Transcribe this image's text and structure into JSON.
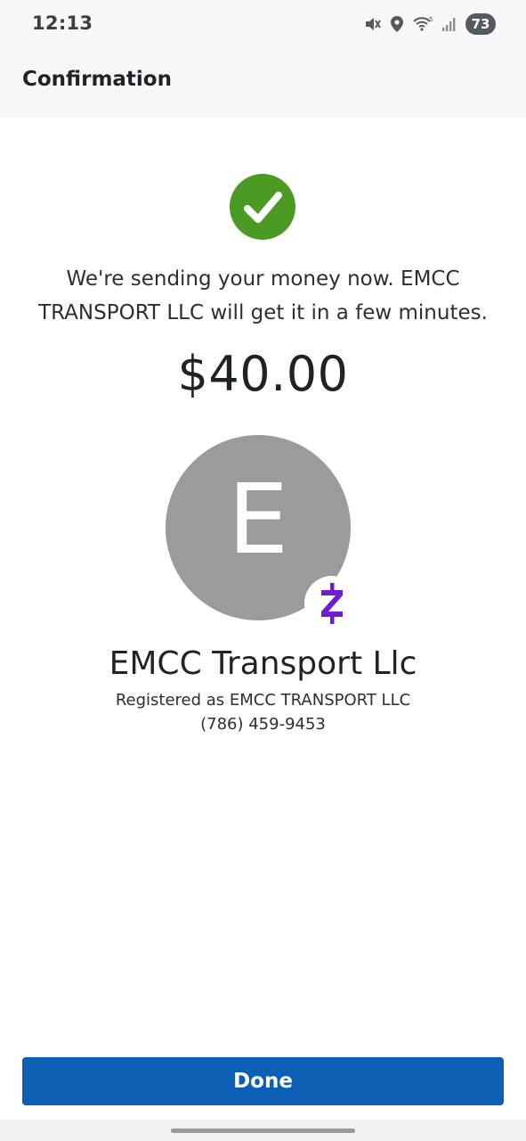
{
  "status_bar": {
    "time": "12:13",
    "battery": "73",
    "icons": [
      "mute-icon",
      "location-icon",
      "wifi-icon",
      "signal-icon"
    ]
  },
  "header": {
    "title": "Confirmation"
  },
  "confirmation": {
    "success_icon": "check-circle-icon",
    "message": "We're sending your money now. EMCC TRANSPORT LLC will get it in a few minutes.",
    "amount": "$40.00"
  },
  "recipient": {
    "initial": "E",
    "badge_icon": "zelle-logo-icon",
    "name": "EMCC Transport Llc",
    "registered_as": "Registered as EMCC TRANSPORT LLC",
    "phone": "(786) 459-9453"
  },
  "actions": {
    "done_label": "Done"
  },
  "colors": {
    "success_green": "#4a9a24",
    "primary_blue": "#0c5fb4",
    "avatar_gray": "#9b9b9b",
    "zelle_purple": "#6d1ed4"
  }
}
